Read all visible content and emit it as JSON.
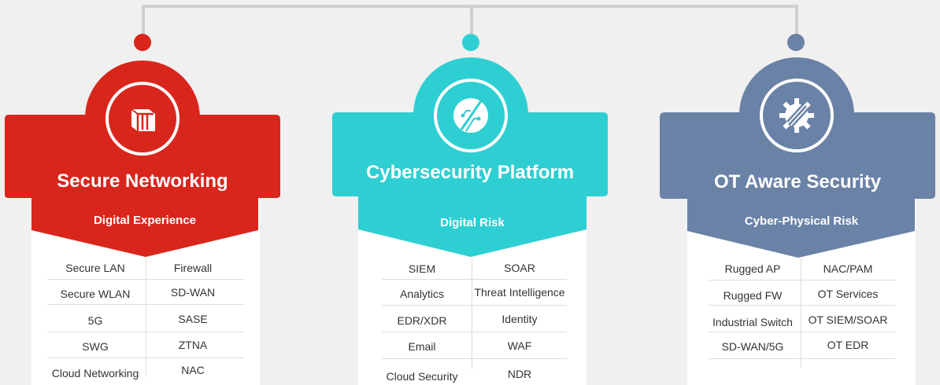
{
  "pillars": [
    {
      "title": "Secure Networking",
      "subtitle": "Digital Experience",
      "color": "#d9261c",
      "icon": "secure-networking-icon",
      "left_items": [
        "Secure LAN",
        "Secure WLAN",
        "5G",
        "SWG",
        "Cloud Networking"
      ],
      "right_items": [
        "Firewall",
        "SD-WAN",
        "SASE",
        "ZTNA",
        "NAC"
      ]
    },
    {
      "title": "Cybersecurity Platform",
      "subtitle": "Digital Risk",
      "color": "#2ecfd2",
      "icon": "cybersecurity-platform-icon",
      "left_items": [
        "SIEM",
        "Analytics",
        "EDR/XDR",
        "Email",
        "Cloud Security"
      ],
      "right_items": [
        "SOAR",
        "Threat Intelligence",
        "Identity",
        "WAF",
        "NDR"
      ]
    },
    {
      "title": "OT Aware Security",
      "subtitle": "Cyber-Physical Risk",
      "color": "#6a82a6",
      "icon": "ot-gear-icon",
      "left_items": [
        "Rugged AP",
        "Rugged FW",
        "Industrial Switch",
        "SD-WAN/5G"
      ],
      "right_items": [
        "NAC/PAM",
        "OT Services",
        "OT SIEM/SOAR",
        "OT EDR"
      ]
    }
  ]
}
